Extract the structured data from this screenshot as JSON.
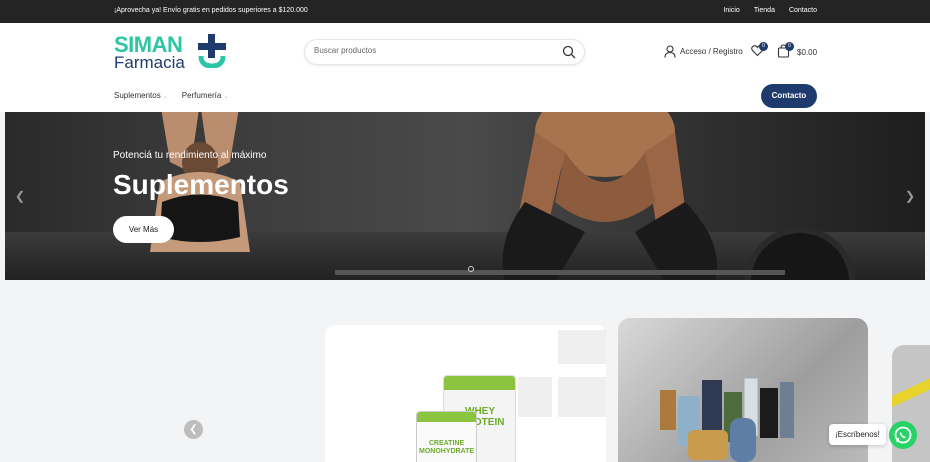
{
  "topbar": {
    "promo": "¡Aprovecha ya! Envío gratis en pedidos superiores a $120.000",
    "links": [
      "Inicio",
      "Tienda",
      "Contacto"
    ]
  },
  "header": {
    "logo_line1": "SIMAN",
    "logo_line2": "Farmacia",
    "search_placeholder": "Buscar productos",
    "account_label": "Acceso / Registro",
    "wishlist_count": "0",
    "cart_count": "0",
    "cart_total": "$0.00",
    "brand_color": "#1f3b6d",
    "accent_color": "#2ec4a6"
  },
  "nav": {
    "items": [
      "Suplementos",
      "Perfumería"
    ],
    "contact_button": "Contacto"
  },
  "hero": {
    "subtitle": "Potenciá tu rendimiento al máximo",
    "title": "Suplementos",
    "cta": "Ver Más"
  },
  "products": {
    "whey_label": "WHEY PROTEIN",
    "creatine_label": "CREATINE MONOHYDRATE"
  },
  "whatsapp": {
    "label": "¡Escríbenos!"
  }
}
